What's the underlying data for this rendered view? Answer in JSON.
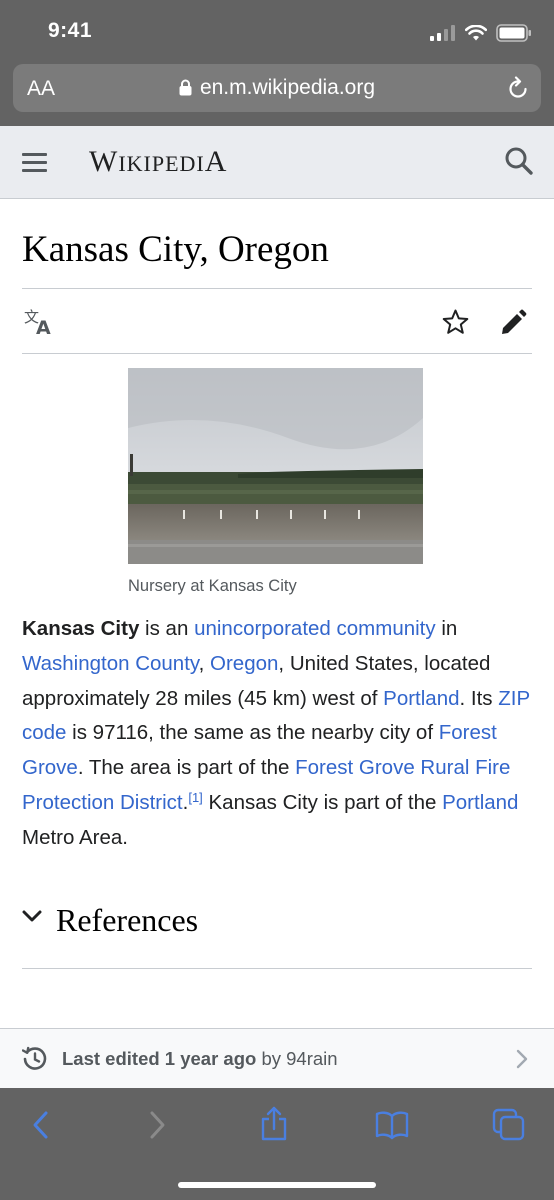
{
  "status_bar": {
    "time": "9:41"
  },
  "browser": {
    "text_size_label": "AA",
    "url": "en.m.wikipedia.org"
  },
  "header": {
    "wordmark": "Wikipedia"
  },
  "article": {
    "title": "Kansas City, Oregon",
    "image_caption": "Nursery at Kansas City",
    "paragraph": [
      {
        "text": "Kansas City",
        "type": "bold"
      },
      {
        "text": " is an ",
        "type": "text"
      },
      {
        "text": "unincorporated community",
        "type": "link"
      },
      {
        "text": " in ",
        "type": "text"
      },
      {
        "text": "Washington County",
        "type": "link"
      },
      {
        "text": ", ",
        "type": "text"
      },
      {
        "text": "Oregon",
        "type": "link"
      },
      {
        "text": ", United States, located approximately 28 miles (45 km) west of ",
        "type": "text"
      },
      {
        "text": "Portland",
        "type": "link"
      },
      {
        "text": ". Its ",
        "type": "text"
      },
      {
        "text": "ZIP code",
        "type": "link"
      },
      {
        "text": " is 97116, the same as the nearby city of ",
        "type": "text"
      },
      {
        "text": "Forest Grove",
        "type": "link"
      },
      {
        "text": ". The area is part of the ",
        "type": "text"
      },
      {
        "text": "Forest Grove Rural Fire Protection District",
        "type": "link"
      },
      {
        "text": ".",
        "type": "text"
      },
      {
        "text": "[1]",
        "type": "cite"
      },
      {
        "text": " Kansas City is part of the ",
        "type": "text"
      },
      {
        "text": "Portland",
        "type": "link"
      },
      {
        "text": " Metro Area.",
        "type": "text"
      }
    ],
    "references_heading": "References"
  },
  "last_edited": {
    "prefix": "Last edited 1 year ago",
    "suffix": " by 94rain"
  },
  "colors": {
    "link": "#3366cc",
    "chrome": "#636363",
    "toolbar_icon": "#4a7fe0"
  },
  "icons": [
    "menu-icon",
    "search-icon",
    "translate-icon",
    "star-icon",
    "pencil-icon",
    "chevron-down-icon",
    "history-icon",
    "chevron-right-icon",
    "back-icon",
    "forward-icon",
    "share-icon",
    "bookmarks-icon",
    "tabs-icon",
    "lock-icon",
    "reload-icon"
  ]
}
